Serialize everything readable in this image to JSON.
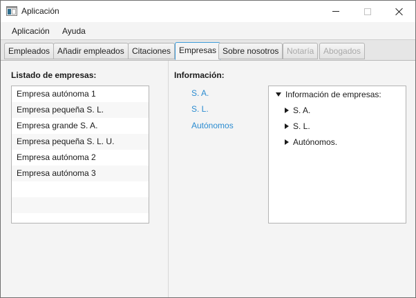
{
  "window": {
    "title": "Aplicación",
    "controls": {
      "minimize_icon": "minimize-icon",
      "maximize_icon": "maximize-icon",
      "close_icon": "close-icon"
    }
  },
  "menubar": {
    "items": [
      {
        "label": "Aplicación"
      },
      {
        "label": "Ayuda"
      }
    ]
  },
  "tabs": [
    {
      "label": "Empleados",
      "active": false,
      "disabled": false
    },
    {
      "label": "Añadir empleados",
      "active": false,
      "disabled": false
    },
    {
      "label": "Citaciones",
      "active": false,
      "disabled": false
    },
    {
      "label": "Empresas",
      "active": true,
      "disabled": false
    },
    {
      "label": "Sobre nosotros",
      "active": false,
      "disabled": false
    },
    {
      "label": "Notaría",
      "active": false,
      "disabled": true
    },
    {
      "label": "Abogados",
      "active": false,
      "disabled": true
    }
  ],
  "companies": {
    "heading": "Listado de empresas:",
    "items": [
      "Empresa autónoma 1",
      "Empresa pequeña S. L.",
      "Empresa grande S. A.",
      "Empresa pequeña S. L. U.",
      "Empresa autónoma 2",
      "Empresa autónoma 3"
    ]
  },
  "info": {
    "heading": "Información:",
    "links": [
      "S. A.",
      "S. L.",
      "Autónomos"
    ],
    "tree": {
      "root": "Información de empresas:",
      "children": [
        "S. A.",
        "S. L.",
        "Autónomos."
      ]
    }
  },
  "colors": {
    "accent": "#3a9ad9",
    "link": "#2a8bd0",
    "disabled_text": "#a8a8a8"
  }
}
